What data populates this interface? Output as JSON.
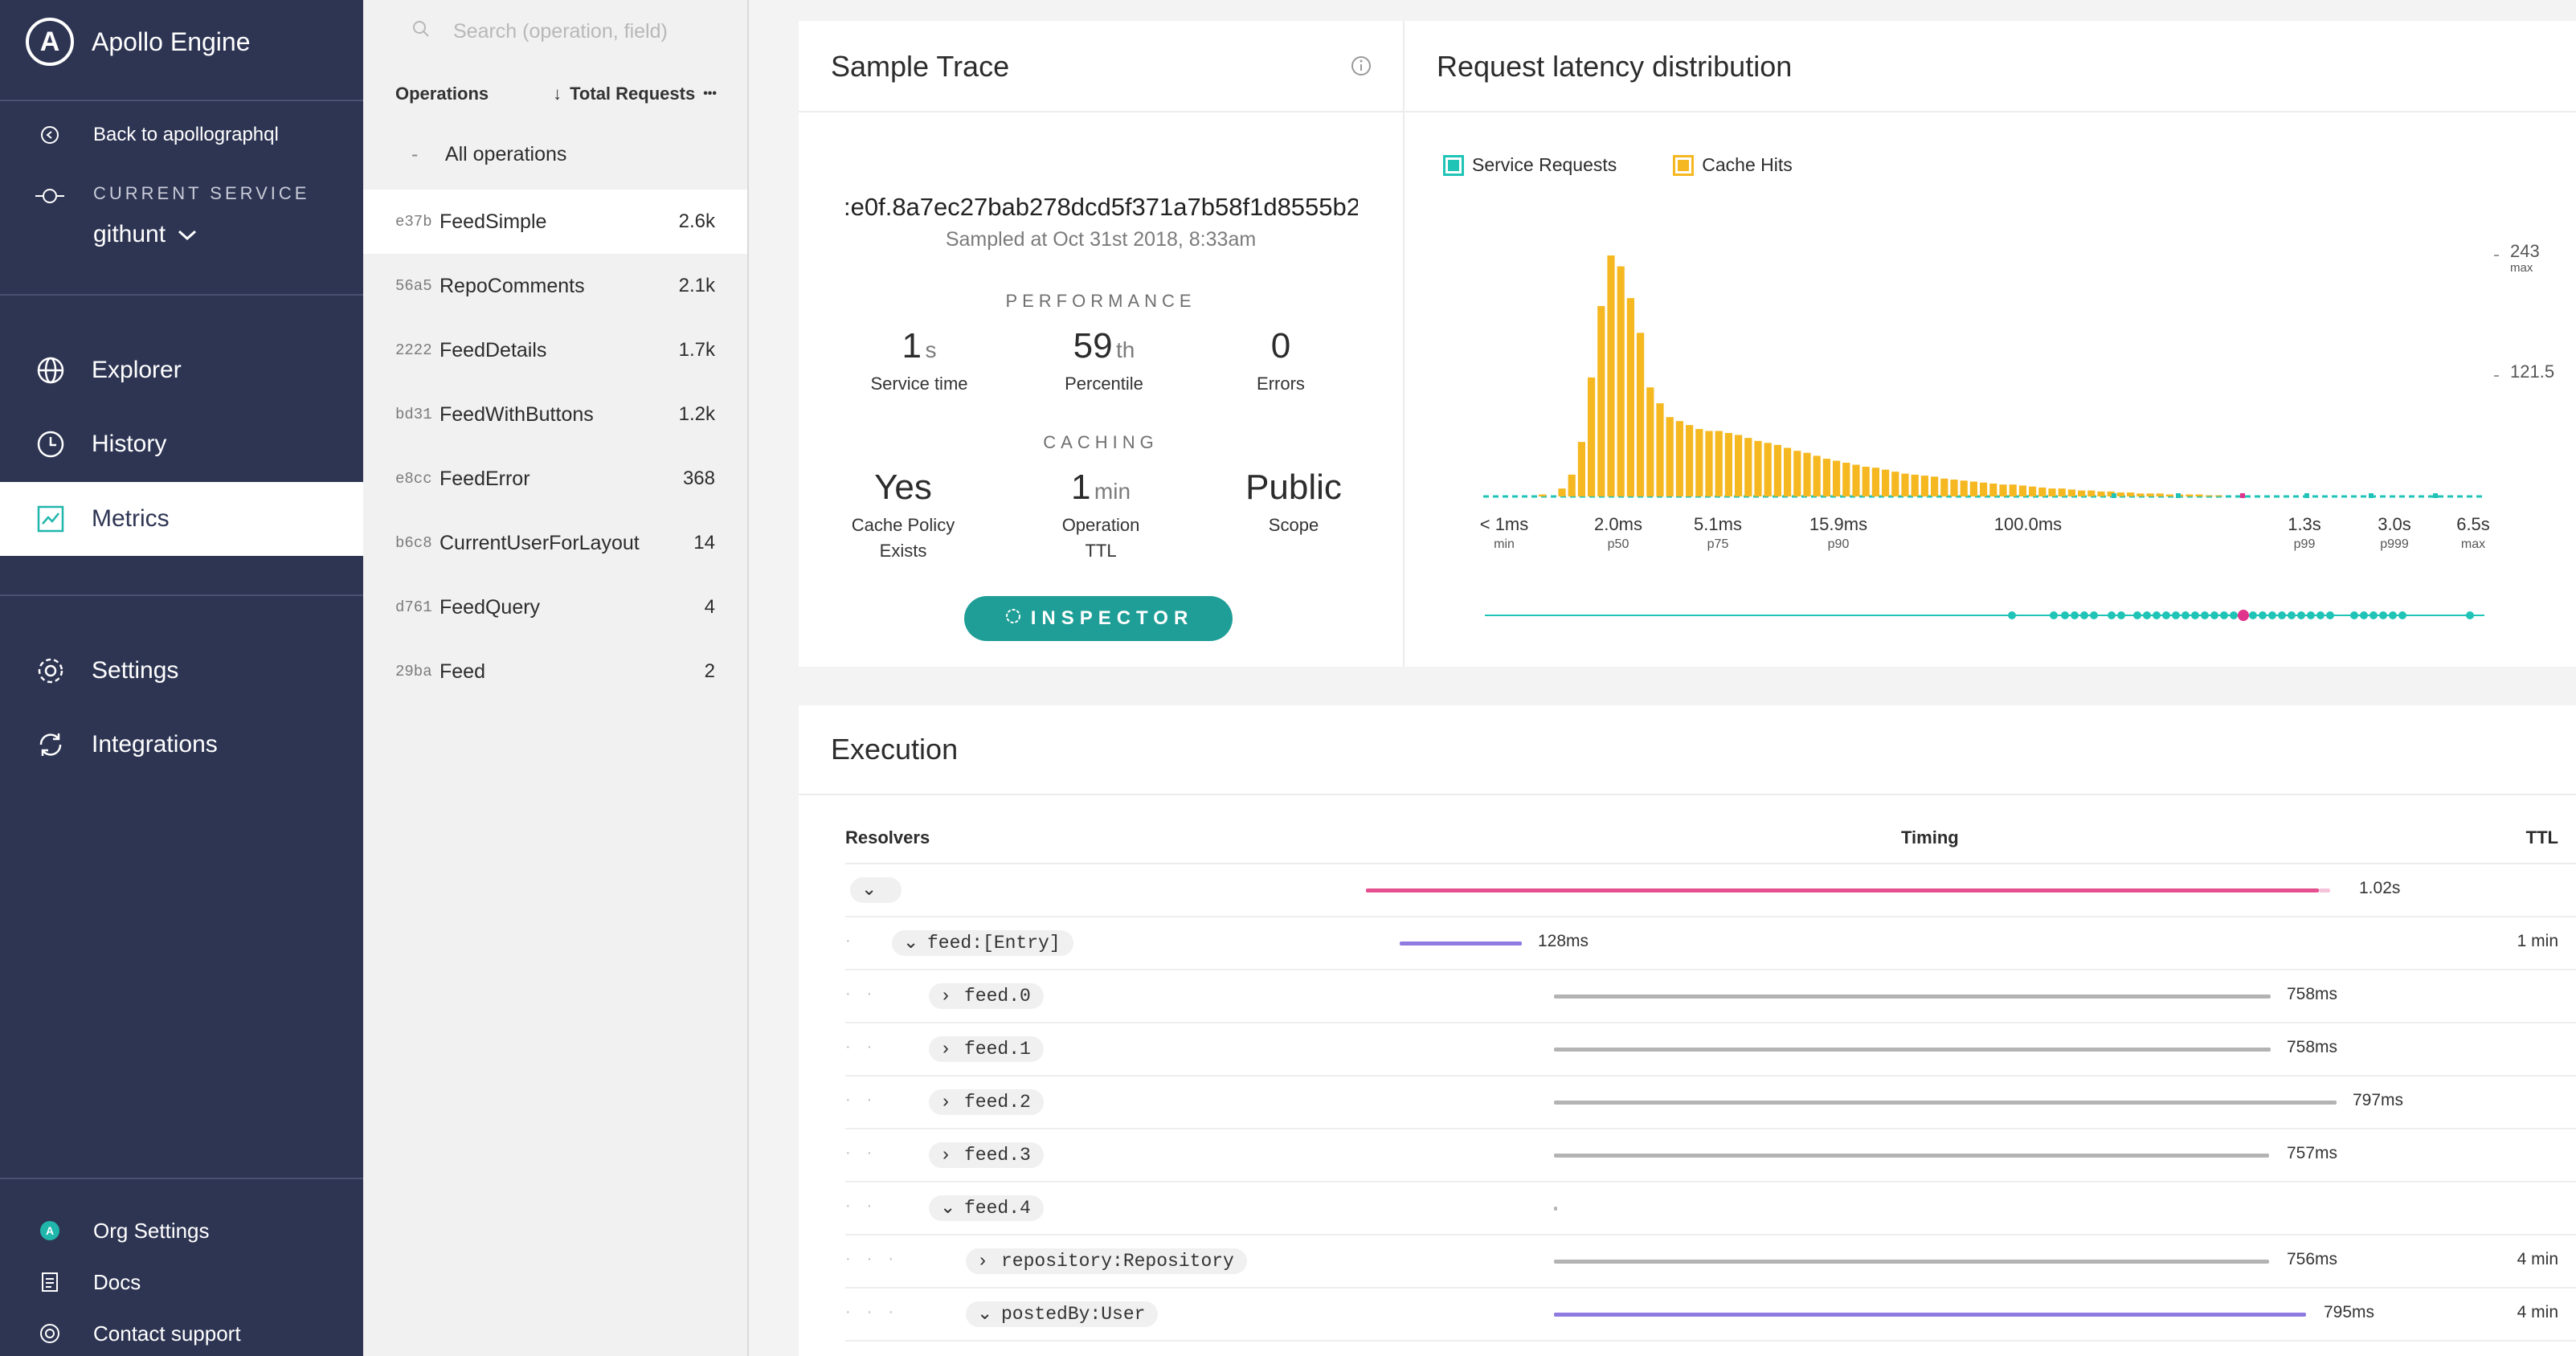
{
  "brand": {
    "name": "Apollo Engine",
    "logo_letter": "A"
  },
  "sidebar": {
    "back_label": "Back to apollographql",
    "current_service_label": "CURRENT SERVICE",
    "service_name": "githunt",
    "nav": [
      {
        "label": "Explorer",
        "icon": "globe-icon"
      },
      {
        "label": "History",
        "icon": "clock-icon"
      },
      {
        "label": "Metrics",
        "icon": "chart-icon",
        "active": true
      },
      {
        "label": "Settings",
        "icon": "gear-icon"
      },
      {
        "label": "Integrations",
        "icon": "sync-icon"
      }
    ],
    "footer": [
      {
        "label": "Org Settings",
        "icon": "apollo-badge-icon"
      },
      {
        "label": "Docs",
        "icon": "doc-icon"
      },
      {
        "label": "Contact support",
        "icon": "lifebuoy-icon"
      }
    ]
  },
  "operations": {
    "search_placeholder": "Search (operation, field)",
    "header_left": "Operations",
    "header_right": "Total Requests",
    "sort_arrow": "↓",
    "more": "•••",
    "all_label": "All operations",
    "all_prefix": "-",
    "items": [
      {
        "id": "e37b",
        "name": "FeedSimple",
        "count": "2.6k",
        "selected": true
      },
      {
        "id": "56a5",
        "name": "RepoComments",
        "count": "2.1k"
      },
      {
        "id": "2222",
        "name": "FeedDetails",
        "count": "1.7k"
      },
      {
        "id": "bd31",
        "name": "FeedWithButtons",
        "count": "1.2k"
      },
      {
        "id": "e8cc",
        "name": "FeedError",
        "count": "368"
      },
      {
        "id": "b6c8",
        "name": "CurrentUserForLayout",
        "count": "14"
      },
      {
        "id": "d761",
        "name": "FeedQuery",
        "count": "4"
      },
      {
        "id": "29ba",
        "name": "Feed",
        "count": "2"
      }
    ]
  },
  "sample_trace": {
    "title": "Sample Trace",
    "trace_id": ":e0f.8a7ec27bab278dcd5f371a7b58f1d8555b2",
    "sampled_at": "Sampled at Oct 31st 2018, 8:33am",
    "performance_heading": "PERFORMANCE",
    "caching_heading": "CACHING",
    "service_time": {
      "value": "1",
      "unit": "s",
      "label": "Service time"
    },
    "percentile": {
      "value": "59",
      "unit": "th",
      "label": "Percentile"
    },
    "errors": {
      "value": "0",
      "unit": "",
      "label": "Errors"
    },
    "cache_policy": {
      "value": "Yes",
      "label1": "Cache Policy",
      "label2": "Exists"
    },
    "operation_ttl": {
      "value": "1",
      "unit": "min",
      "label1": "Operation",
      "label2": "TTL"
    },
    "scope": {
      "value": "Public",
      "label": "Scope"
    },
    "inspector_label": "INSPECTOR"
  },
  "latency": {
    "title": "Request latency distribution",
    "legend": [
      {
        "label": "Service Requests",
        "color": "#20c4b7"
      },
      {
        "label": "Cache Hits",
        "color": "#f5b820"
      }
    ],
    "y_ticks": [
      {
        "value": "243",
        "sub": "max"
      },
      {
        "value": "121.5",
        "sub": ""
      }
    ]
  },
  "chart_data": {
    "type": "bar",
    "title": "Request latency distribution",
    "ylim": [
      0,
      243
    ],
    "series": [
      {
        "name": "Service Requests",
        "color": "#20c4b7"
      },
      {
        "name": "Cache Hits",
        "color": "#f5b820"
      }
    ],
    "x_ticks": [
      {
        "label": "< 1ms",
        "sub": "min"
      },
      {
        "label": "2.0ms",
        "sub": "p50"
      },
      {
        "label": "5.1ms",
        "sub": "p75"
      },
      {
        "label": "15.9ms",
        "sub": "p90"
      },
      {
        "label": "100.0ms",
        "sub": ""
      },
      {
        "label": "1.3s",
        "sub": "p99"
      },
      {
        "label": "3.0s",
        "sub": "p999"
      },
      {
        "label": "6.5s",
        "sub": "max"
      }
    ],
    "values": [
      0,
      0,
      0,
      0,
      0,
      2,
      0,
      8,
      22,
      55,
      120,
      192,
      243,
      232,
      200,
      165,
      110,
      94,
      80,
      76,
      72,
      68,
      66,
      66,
      64,
      62,
      59,
      56,
      54,
      52,
      49,
      46,
      44,
      41,
      38,
      36,
      34,
      32,
      30,
      29,
      27,
      25,
      23,
      22,
      21,
      20,
      18,
      17,
      16,
      15,
      14,
      13,
      12,
      12,
      11,
      10,
      9,
      8,
      8,
      7,
      6,
      6,
      5,
      5,
      4,
      4,
      3,
      3,
      3,
      2,
      2,
      2,
      2,
      1,
      1
    ]
  },
  "execution": {
    "title": "Execution",
    "col_resolvers": "Resolvers",
    "col_timing": "Timing",
    "col_ttl": "TTL",
    "rows": [
      {
        "label": "",
        "chev": "⌄",
        "timing": "1.02s",
        "ttl": "",
        "depth": 0
      },
      {
        "label": "feed:[Entry]",
        "chev": "⌄",
        "timing": "128ms",
        "ttl": "1 min",
        "depth": 1
      },
      {
        "label": "feed.0",
        "chev": "›",
        "timing": "758ms",
        "ttl": "",
        "depth": 2
      },
      {
        "label": "feed.1",
        "chev": "›",
        "timing": "758ms",
        "ttl": "",
        "depth": 2
      },
      {
        "label": "feed.2",
        "chev": "›",
        "timing": "797ms",
        "ttl": "",
        "depth": 2
      },
      {
        "label": "feed.3",
        "chev": "›",
        "timing": "757ms",
        "ttl": "",
        "depth": 2
      },
      {
        "label": "feed.4",
        "chev": "⌄",
        "timing": "",
        "ttl": "",
        "depth": 2
      },
      {
        "label": "repository:Repository",
        "chev": "›",
        "timing": "756ms",
        "ttl": "4 min",
        "depth": 3
      },
      {
        "label": "postedBy:User",
        "chev": "⌄",
        "timing": "795ms",
        "ttl": "4 min",
        "depth": 3
      }
    ]
  }
}
